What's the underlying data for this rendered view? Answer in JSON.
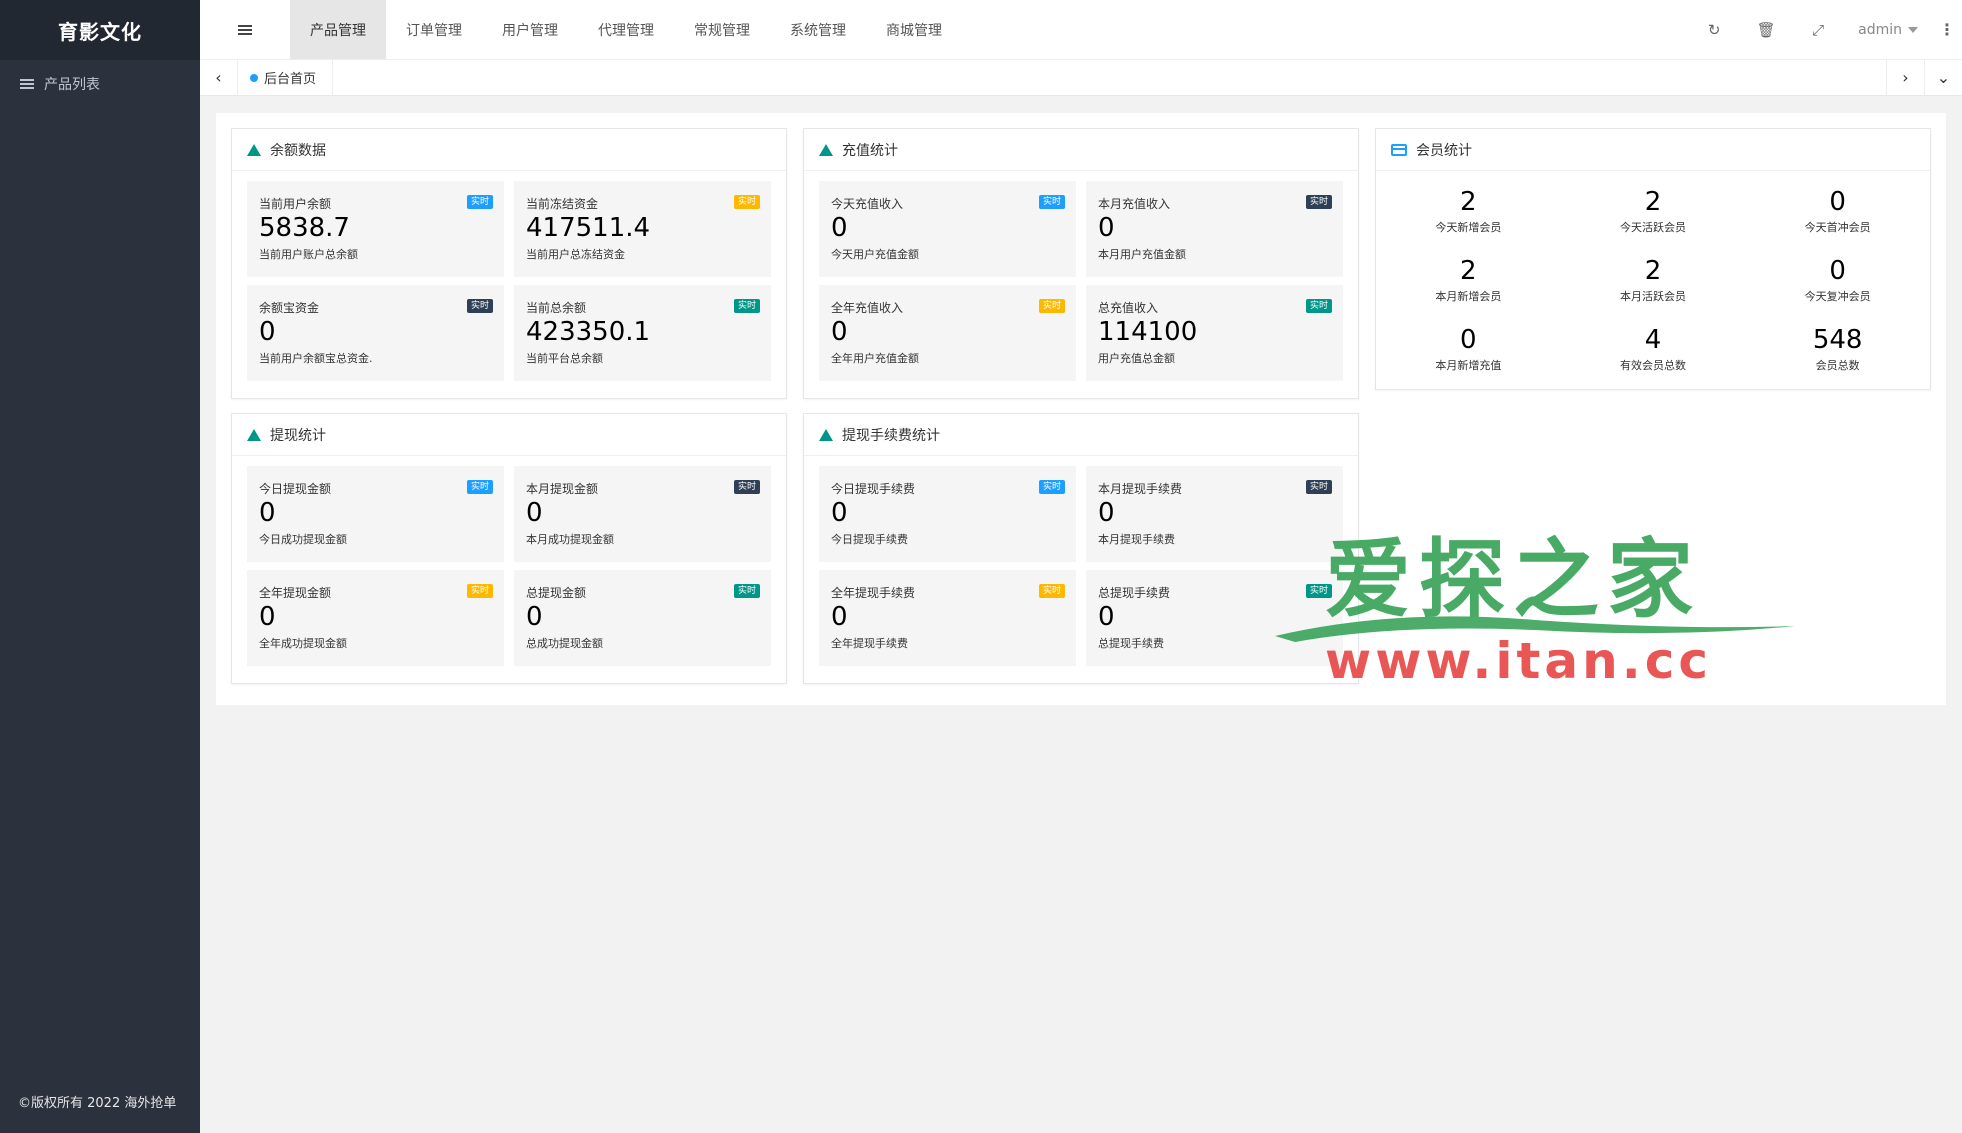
{
  "brand": "育影文化",
  "sidebar": {
    "items": [
      {
        "label": "产品列表",
        "icon": "list-icon"
      }
    ],
    "copyright": "©版权所有 2022 海外抢单"
  },
  "header": {
    "tabs": [
      "产品管理",
      "订单管理",
      "用户管理",
      "代理管理",
      "常规管理",
      "系统管理",
      "商城管理"
    ],
    "active_tab": "产品管理",
    "user": "admin"
  },
  "tabbar": {
    "home_tab": "后台首页"
  },
  "colors": {
    "sidebar": "#2b323d",
    "blue": "#1e9fff",
    "dark": "#2f4056",
    "orange": "#ffb800",
    "green": "#009688"
  },
  "panels": {
    "balance": {
      "title": "余额数据",
      "stats": [
        {
          "title": "当前用户余额",
          "badge": "实时",
          "badge_color": "blue",
          "value": "5838.7",
          "desc": "当前用户账户总余额"
        },
        {
          "title": "当前冻结资金",
          "badge": "实时",
          "badge_color": "orange",
          "value": "417511.4",
          "desc": "当前用户总冻结资金"
        },
        {
          "title": "余额宝资金",
          "badge": "实时",
          "badge_color": "dark",
          "value": "0",
          "desc": "当前用户余额宝总资金."
        },
        {
          "title": "当前总余额",
          "badge": "实时",
          "badge_color": "green",
          "value": "423350.1",
          "desc": "当前平台总余额"
        }
      ]
    },
    "recharge": {
      "title": "充值统计",
      "stats": [
        {
          "title": "今天充值收入",
          "badge": "实时",
          "badge_color": "blue",
          "value": "0",
          "desc": "今天用户充值金额"
        },
        {
          "title": "本月充值收入",
          "badge": "实时",
          "badge_color": "dark",
          "value": "0",
          "desc": "本月用户充值金额"
        },
        {
          "title": "全年充值收入",
          "badge": "实时",
          "badge_color": "orange",
          "value": "0",
          "desc": "全年用户充值金额"
        },
        {
          "title": "总充值收入",
          "badge": "实时",
          "badge_color": "green",
          "value": "114100",
          "desc": "用户充值总金额"
        }
      ]
    },
    "members": {
      "title": "会员统计",
      "stats": [
        {
          "value": "2",
          "desc": "今天新增会员"
        },
        {
          "value": "2",
          "desc": "今天活跃会员"
        },
        {
          "value": "0",
          "desc": "今天首冲会员"
        },
        {
          "value": "2",
          "desc": "本月新增会员"
        },
        {
          "value": "2",
          "desc": "本月活跃会员"
        },
        {
          "value": "0",
          "desc": "今天复冲会员"
        },
        {
          "value": "0",
          "desc": "本月新增充值"
        },
        {
          "value": "4",
          "desc": "有效会员总数"
        },
        {
          "value": "548",
          "desc": "会员总数"
        }
      ]
    },
    "withdraw": {
      "title": "提现统计",
      "stats": [
        {
          "title": "今日提现金额",
          "badge": "实时",
          "badge_color": "blue",
          "value": "0",
          "desc": "今日成功提现金额"
        },
        {
          "title": "本月提现金额",
          "badge": "实时",
          "badge_color": "dark",
          "value": "0",
          "desc": "本月成功提现金额"
        },
        {
          "title": "全年提现金额",
          "badge": "实时",
          "badge_color": "orange",
          "value": "0",
          "desc": "全年成功提现金额"
        },
        {
          "title": "总提现金额",
          "badge": "实时",
          "badge_color": "green",
          "value": "0",
          "desc": "总成功提现金额"
        }
      ]
    },
    "fee": {
      "title": "提现手续费统计",
      "stats": [
        {
          "title": "今日提现手续费",
          "badge": "实时",
          "badge_color": "blue",
          "value": "0",
          "desc": "今日提现手续费"
        },
        {
          "title": "本月提现手续费",
          "badge": "实时",
          "badge_color": "dark",
          "value": "0",
          "desc": "本月提现手续费"
        },
        {
          "title": "全年提现手续费",
          "badge": "实时",
          "badge_color": "orange",
          "value": "0",
          "desc": "全年提现手续费"
        },
        {
          "title": "总提现手续费",
          "badge": "实时",
          "badge_color": "green",
          "value": "0",
          "desc": "总提现手续费"
        }
      ]
    }
  },
  "watermark": {
    "cn": "爱探之家",
    "url": "www.itan.cc"
  }
}
